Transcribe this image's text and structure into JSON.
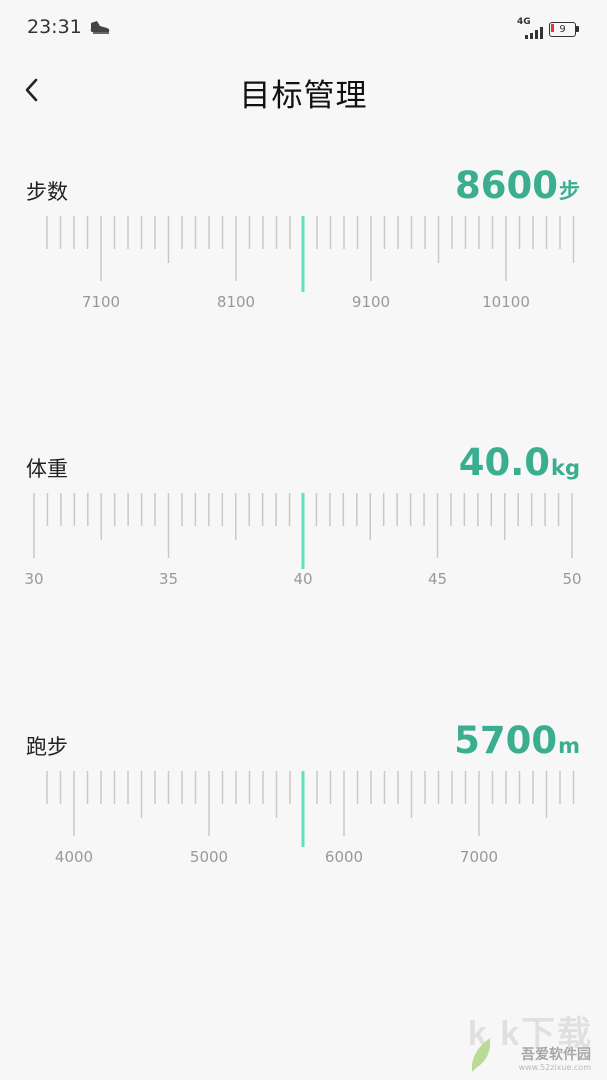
{
  "status_bar": {
    "time": "23:31",
    "network": "4G",
    "battery": "9",
    "icons": [
      "shoe-icon",
      "signal-icon",
      "battery-icon"
    ]
  },
  "header": {
    "title": "目标管理",
    "back_icon": "chevron-left-icon"
  },
  "accent_color": "#3aae8f",
  "sections": [
    {
      "label": "步数",
      "value": "8600",
      "unit": "步",
      "ruler": {
        "ticks": [
          "7100",
          "8100",
          "9100",
          "10100"
        ],
        "selected": 8600
      }
    },
    {
      "label": "体重",
      "value": "40.0",
      "unit": "kg",
      "ruler": {
        "ticks": [
          "30",
          "35",
          "40",
          "45",
          "50"
        ],
        "selected": 40
      }
    },
    {
      "label": "跑步",
      "value": "5700",
      "unit": "m",
      "ruler": {
        "ticks": [
          "4000",
          "5000",
          "6000",
          "7000"
        ],
        "selected": 5700
      }
    }
  ],
  "watermark": {
    "text": "吾爱软件园",
    "url": "www.52zixue.com",
    "logo_text": "k k下载"
  }
}
